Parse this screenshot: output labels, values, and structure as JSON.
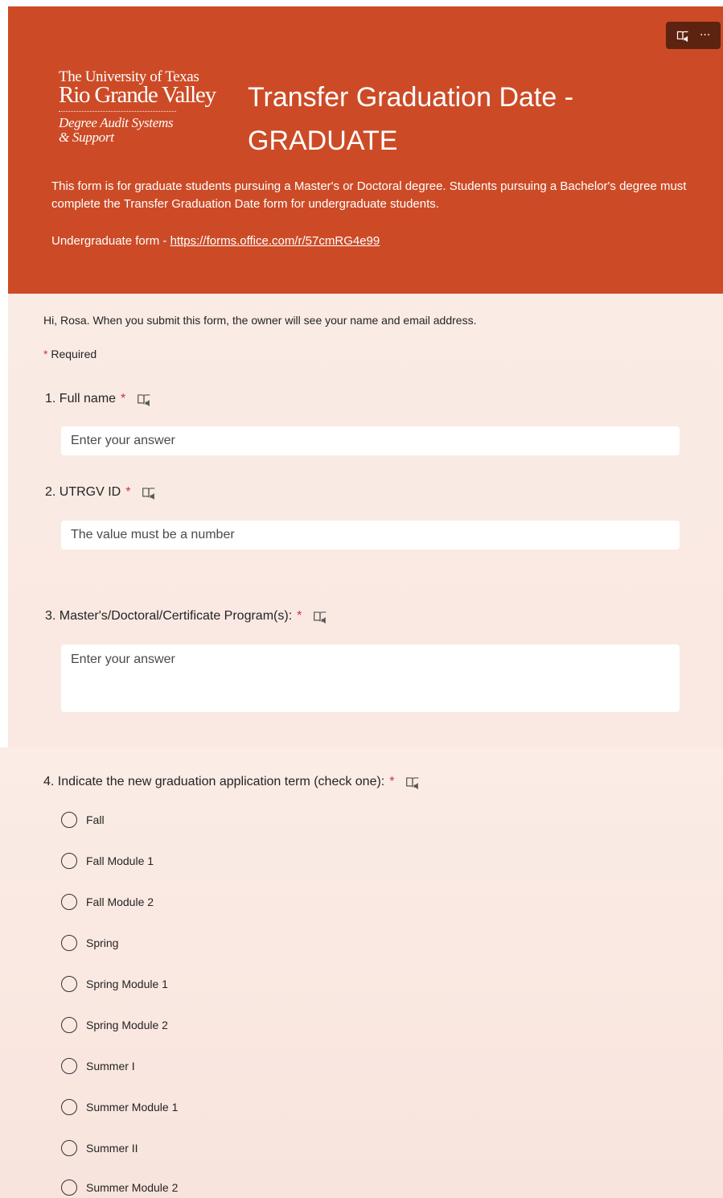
{
  "header": {
    "reader_icon": "immersive-reader-icon",
    "more_icon": "more-options-icon",
    "more_label": "···",
    "logo": {
      "line1": "The University of Texas",
      "line2": "Rio Grande Valley",
      "line3": "Degree Audit Systems",
      "line4": "& Support"
    },
    "title_line1": "Transfer Graduation Date -",
    "title_line2": "GRADUATE",
    "description": "This form is for graduate students pursuing a Master's or Doctoral degree. Students pursuing a Bachelor's degree must complete the Transfer Graduation Date form for undergraduate students.",
    "undergrad_prefix": "Undergraduate form - ",
    "undergrad_link": "https://forms.office.com/r/57cmRG4e99",
    "accent_color": "#cc4b26"
  },
  "form": {
    "greeting": "Hi, Rosa. When you submit this form, the owner will see your name and email address.",
    "required_star": "*",
    "required_text": "Required",
    "questions": [
      {
        "label": "1. Full name",
        "star": "*",
        "placeholder": "Enter your answer"
      },
      {
        "label": "2. UTRGV ID",
        "star": "*",
        "placeholder": "The value must be a number"
      },
      {
        "label": "3. Master's/Doctoral/Certificate Program(s):",
        "star": "*",
        "placeholder": "Enter your answer"
      },
      {
        "label": "4. Indicate the new graduation application term (check one):",
        "star": "*",
        "options": [
          "Fall",
          "Fall Module 1",
          "Fall Module 2",
          "Spring",
          "Spring Module 1",
          "Spring Module 2",
          "Summer I",
          "Summer Module 1",
          "Summer II",
          "Summer Module 2"
        ]
      }
    ]
  }
}
